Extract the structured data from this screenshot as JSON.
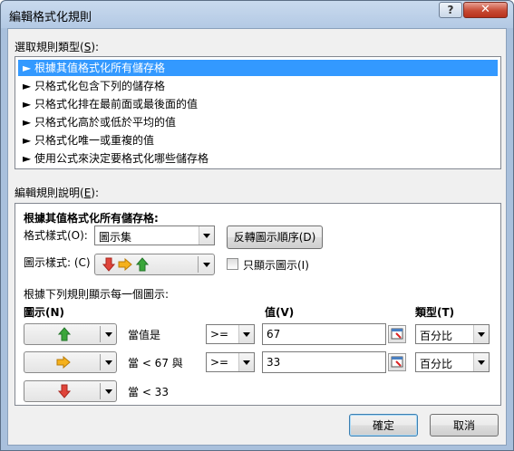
{
  "window": {
    "title": "編輯格式化規則",
    "help_label": "?",
    "close_label": "✕"
  },
  "rule_type": {
    "label_prefix": "選取規則類型(",
    "label_key": "S",
    "label_suffix": "):",
    "items": [
      "► 根據其值格式化所有儲存格",
      "► 只格式化包含下列的儲存格",
      "► 只格式化排在最前面或最後面的值",
      "► 只格式化高於或低於平均的值",
      "► 只格式化唯一或重複的值",
      "► 使用公式來決定要格式化哪些儲存格"
    ],
    "selected_index": 0
  },
  "edit": {
    "label_prefix": "編輯規則說明(",
    "label_key": "E",
    "label_suffix": "):",
    "heading": "根據其值格式化所有儲存格:",
    "format_style_label": "格式樣式(O):",
    "format_style_value": "圖示集",
    "reverse_button": "反轉圖示順序(D)",
    "icon_style_label": "圖示樣式: (C)",
    "icon_only_label": "只顯示圖示(I)",
    "icon_only_checked": false,
    "rules_caption": "根據下列規則顯示每一個圖示:",
    "col_icon": "圖示(N)",
    "col_value": "值(V)",
    "col_type": "類型(T)",
    "rows": [
      {
        "icon": "green-up-arrow",
        "condition": "當值是",
        "operator": ">=",
        "value": "67",
        "type": "百分比"
      },
      {
        "icon": "yellow-right-arrow",
        "condition": "當 < 67 與",
        "operator": ">=",
        "value": "33",
        "type": "百分比"
      },
      {
        "icon": "red-down-arrow",
        "condition": "當 < 33"
      }
    ]
  },
  "buttons": {
    "ok": "確定",
    "cancel": "取消"
  },
  "colors": {
    "selection": "#3399ff",
    "arrow_green": "#3aa63a",
    "arrow_yellow": "#f0b21c",
    "arrow_red": "#e0443a"
  }
}
